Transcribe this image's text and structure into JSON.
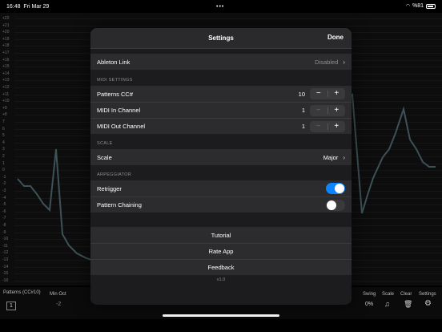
{
  "status": {
    "time": "16:48",
    "date": "Fri Mar 29",
    "dots": "•••",
    "battery": "%81"
  },
  "background": {
    "axis": [
      "+22",
      "+21",
      "+20",
      "+19",
      "+18",
      "+17",
      "+16",
      "+15",
      "+14",
      "+13",
      "+12",
      "+11",
      "+10",
      "+9",
      "+8",
      "7",
      "6",
      "5",
      "4",
      "3",
      "2",
      "1",
      "0",
      "-1",
      "-2",
      "-3",
      "-4",
      "-5",
      "-6",
      "-7",
      "-8",
      "-9",
      "-10",
      "-11",
      "-12",
      "-13",
      "-14",
      "-15",
      "-16"
    ],
    "bottom_labels": {
      "patterns": "Patterns (CC#10)",
      "min_oct": "Min Oct",
      "swing": "Swing",
      "scale": "Scale",
      "clear": "Clear",
      "settings": "Settings"
    },
    "bottom_values": {
      "pattern_num": "1",
      "min_oct_val": "-2",
      "swing_val": "0%"
    }
  },
  "modal": {
    "title": "Settings",
    "done": "Done",
    "ableton": {
      "label": "Ableton Link",
      "value": "Disabled"
    },
    "midi_section": "MIDI SETTINGS",
    "midi_rows": [
      {
        "label": "Patterns CC#",
        "value": "10"
      },
      {
        "label": "MIDI In Channel",
        "value": "1"
      },
      {
        "label": "MIDI Out Channel",
        "value": "1"
      }
    ],
    "stepper_minus": "−",
    "stepper_plus": "+",
    "scale_section": "SCALE",
    "scale": {
      "label": "Scale",
      "value": "Major"
    },
    "arp_section": "ARPEGGIATOR",
    "retrigger": {
      "label": "Retrigger",
      "on": true
    },
    "chaining": {
      "label": "Pattern Chaining",
      "on": false
    },
    "actions": [
      "Tutorial",
      "Rate App",
      "Feedback"
    ],
    "version": "v1.0"
  },
  "colors": {
    "accent": "#0a84ff",
    "modal_bg": "#1c1c1e",
    "row_bg": "#2c2c2e"
  }
}
